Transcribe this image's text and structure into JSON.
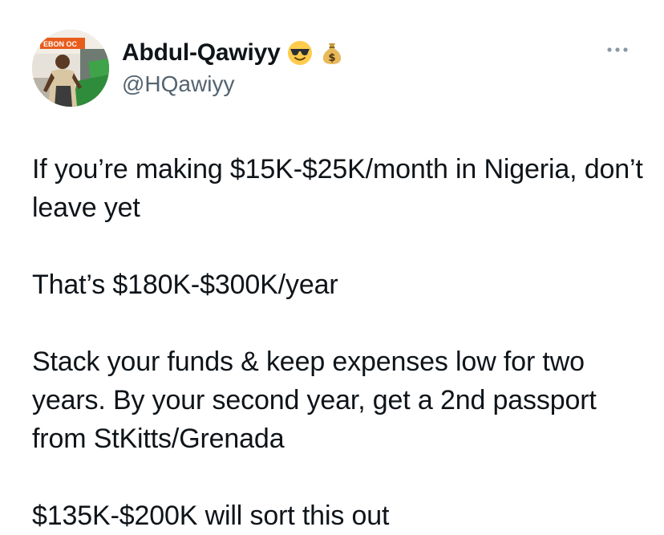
{
  "author": {
    "display_name": "Abdul-Qawiyy",
    "handle": "@HQawiyy",
    "name_emojis": [
      "smiling-face-with-sunglasses-icon",
      "money-bag-icon"
    ],
    "avatar_sign_text": "EBON OC"
  },
  "tweet": {
    "paragraphs": [
      "If you’re making $15K-$25K/month in Nigeria, don’t leave yet",
      "That’s $180K-$300K/year",
      "Stack your funds & keep expenses low for two years. By your second year, get a 2nd passport from StKitts/Grenada",
      "$135K-$200K will sort this out"
    ]
  },
  "icons": {
    "more": "more-horizontal-icon"
  },
  "colors": {
    "text_primary": "#0f1419",
    "text_secondary": "#536471",
    "background": "#ffffff"
  }
}
